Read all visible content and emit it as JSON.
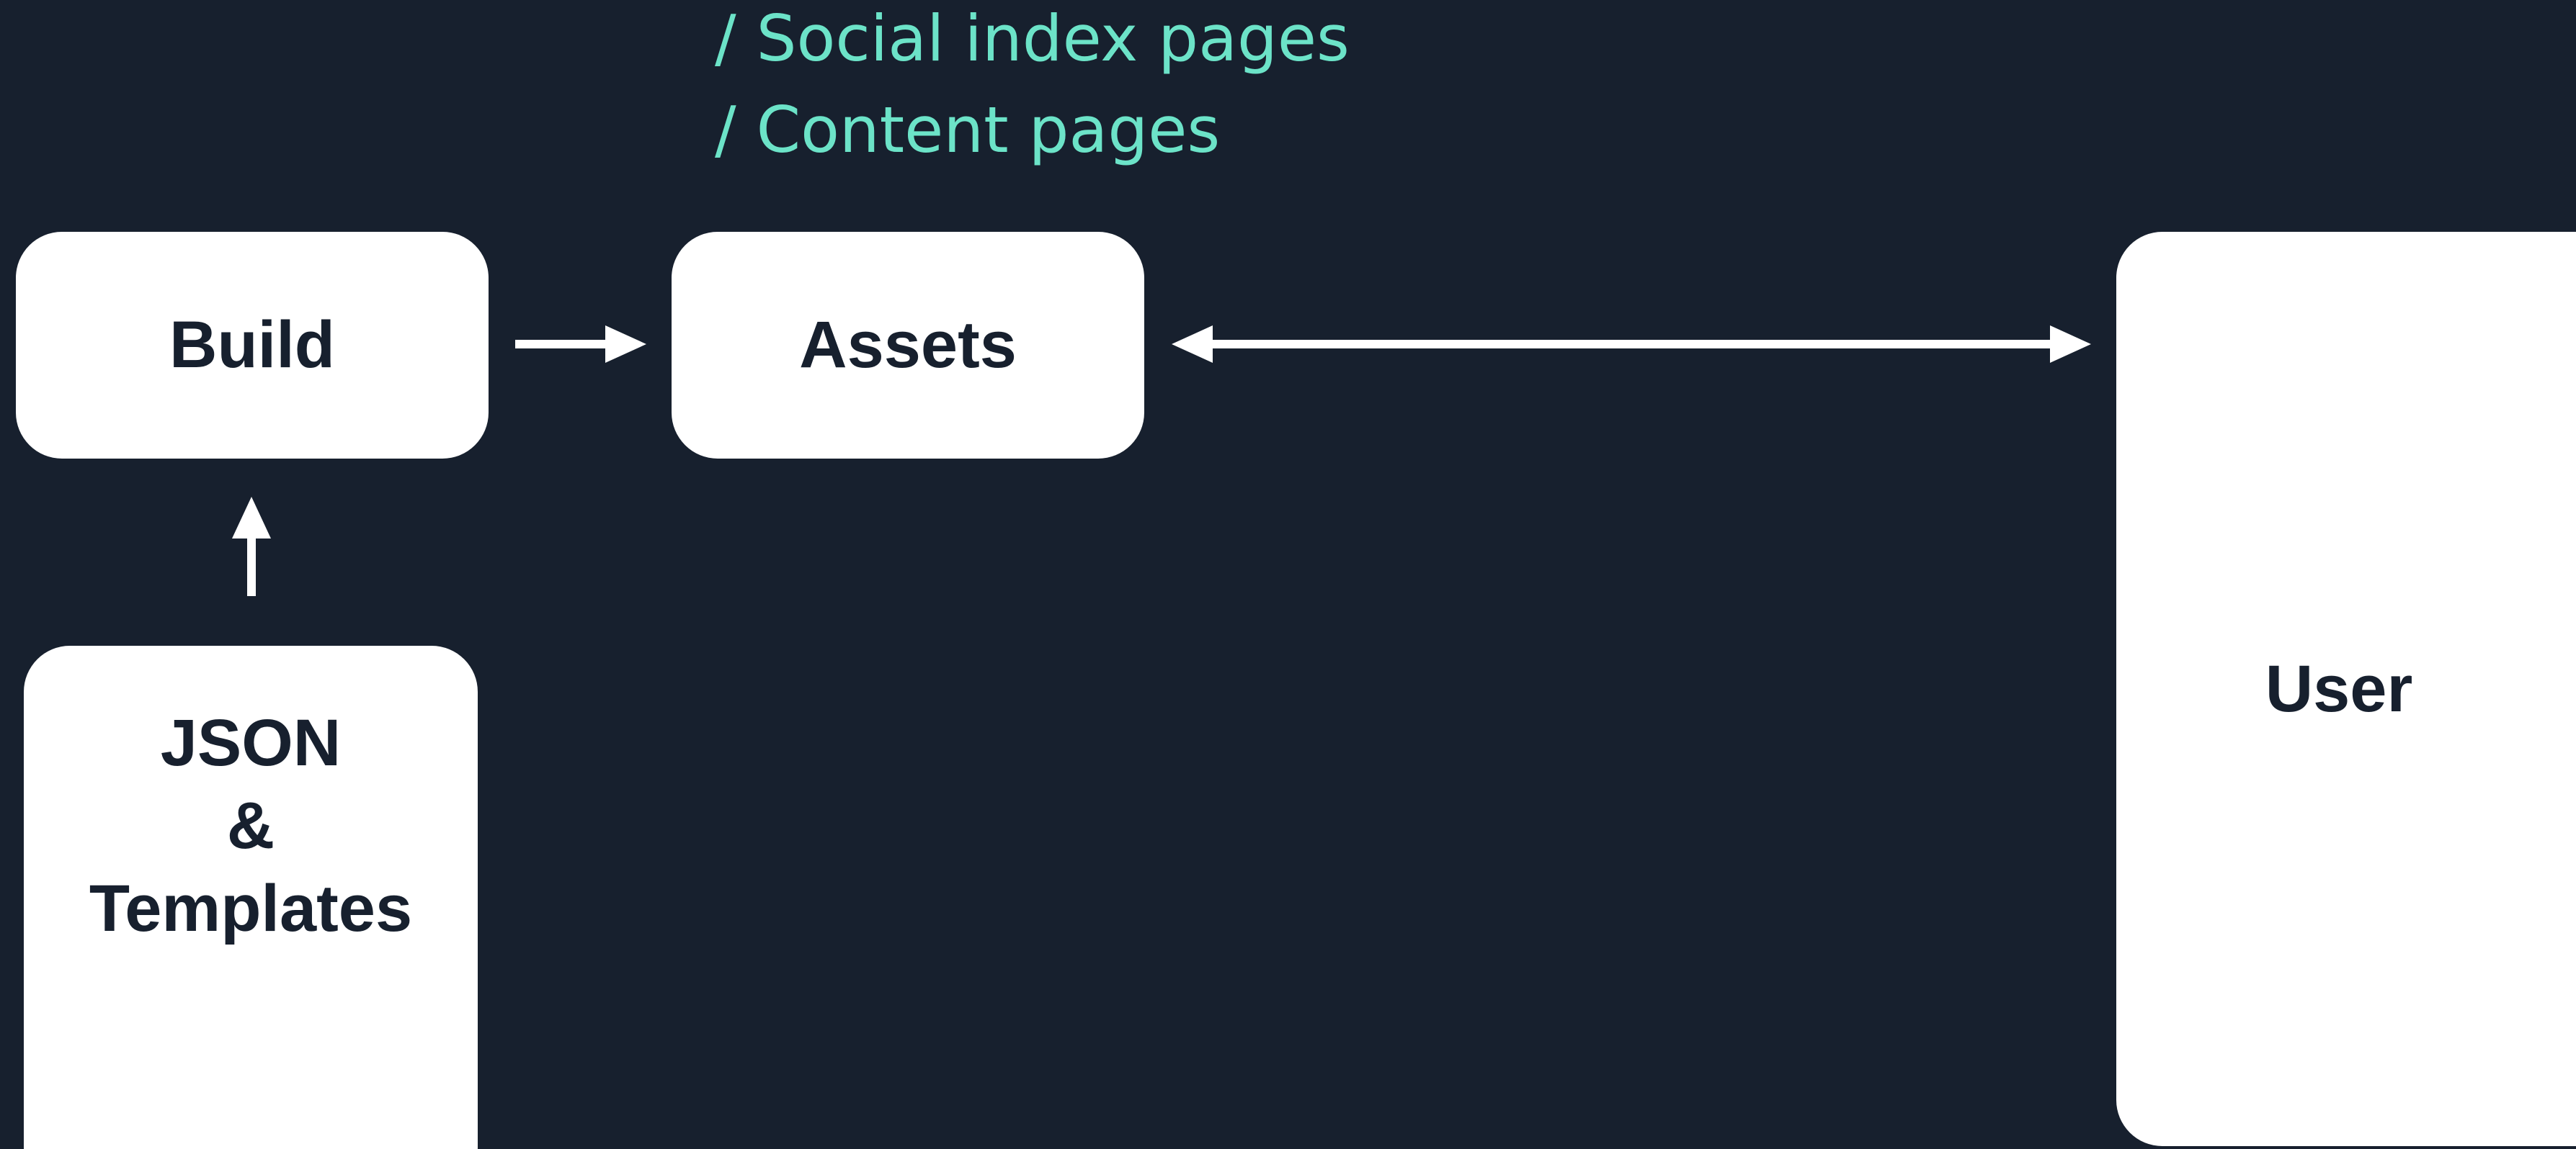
{
  "captions": [
    "/ Social index pages",
    "/ Content pages"
  ],
  "nodes": {
    "build": "Build",
    "assets": "Assets",
    "user": "User",
    "source": {
      "line1": "JSON",
      "line2": "&",
      "line3": "Templates"
    }
  },
  "colors": {
    "background": "#17202e",
    "node_fill": "#ffffff",
    "node_text": "#17202e",
    "caption_text": "#6ce3c8",
    "arrow": "#ffffff"
  }
}
